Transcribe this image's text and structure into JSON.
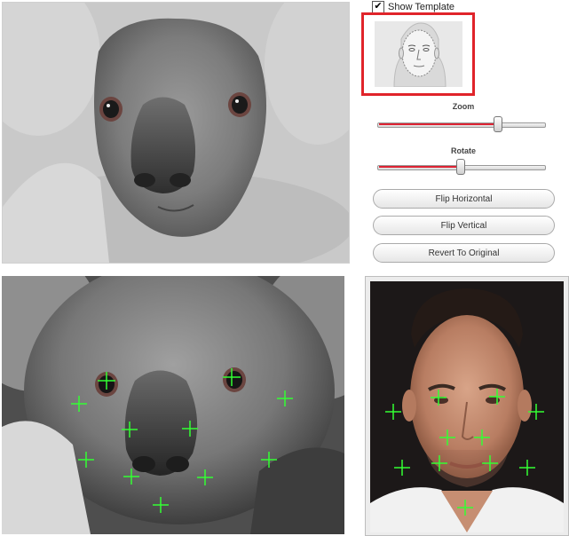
{
  "template_options": {
    "show_template_label": "Show Template",
    "show_template_checked": true,
    "checkmark": "✔"
  },
  "controls": {
    "zoom": {
      "label": "Zoom",
      "level": 0.72
    },
    "rotate": {
      "label": "Rotate",
      "level": 0.49
    },
    "buttons": {
      "flip_horizontal": "Flip Horizontal",
      "flip_vertical": "Flip Vertical",
      "revert": "Revert To Original"
    }
  },
  "colors": {
    "highlight_border": "#e0242a",
    "marker": "#33ff33",
    "slider_fill": "#dd2233"
  },
  "icons": {
    "template_thumbnail": "face-outline-icon",
    "feature_marker": "crosshair-icon"
  }
}
